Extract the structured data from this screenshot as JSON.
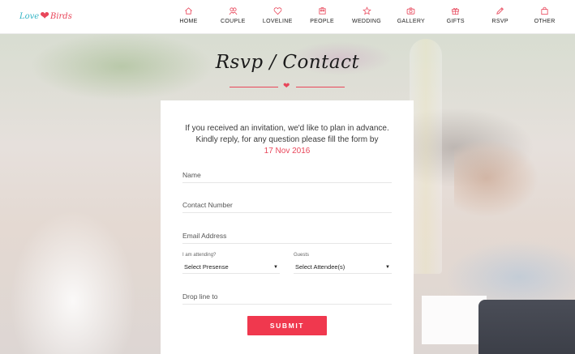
{
  "header": {
    "logo": {
      "part1": "Love",
      "part2": "Birds"
    },
    "nav": [
      {
        "label": "HOME",
        "icon": "home-icon"
      },
      {
        "label": "COUPLE",
        "icon": "couple-icon"
      },
      {
        "label": "LOVELINE",
        "icon": "heart-icon"
      },
      {
        "label": "PEOPLE",
        "icon": "people-icon"
      },
      {
        "label": "WEDDING",
        "icon": "star-icon"
      },
      {
        "label": "GALLERY",
        "icon": "camera-icon"
      },
      {
        "label": "GIFTS",
        "icon": "gift-icon"
      },
      {
        "label": "RSVP",
        "icon": "pen-icon"
      },
      {
        "label": "OTHER",
        "icon": "bag-icon"
      }
    ]
  },
  "page": {
    "title": "Rsvp / Contact"
  },
  "form": {
    "intro_line1": "If you received an invitation, we'd like to plan in advance.",
    "intro_line2": "Kindly reply, for any question please fill the form by",
    "deadline": "17 Nov 2016",
    "name_placeholder": "Name",
    "contact_placeholder": "Contact Number",
    "email_placeholder": "Email Address",
    "attending_caption": "I am attending?",
    "attending_value": "Select Presense",
    "guests_caption": "Guests",
    "guests_value": "Select Attendee(s)",
    "message_placeholder": "Drop line to",
    "submit_label": "SUBMIT"
  },
  "colors": {
    "accent": "#f0384e",
    "logo_teal": "#37b6c6"
  }
}
